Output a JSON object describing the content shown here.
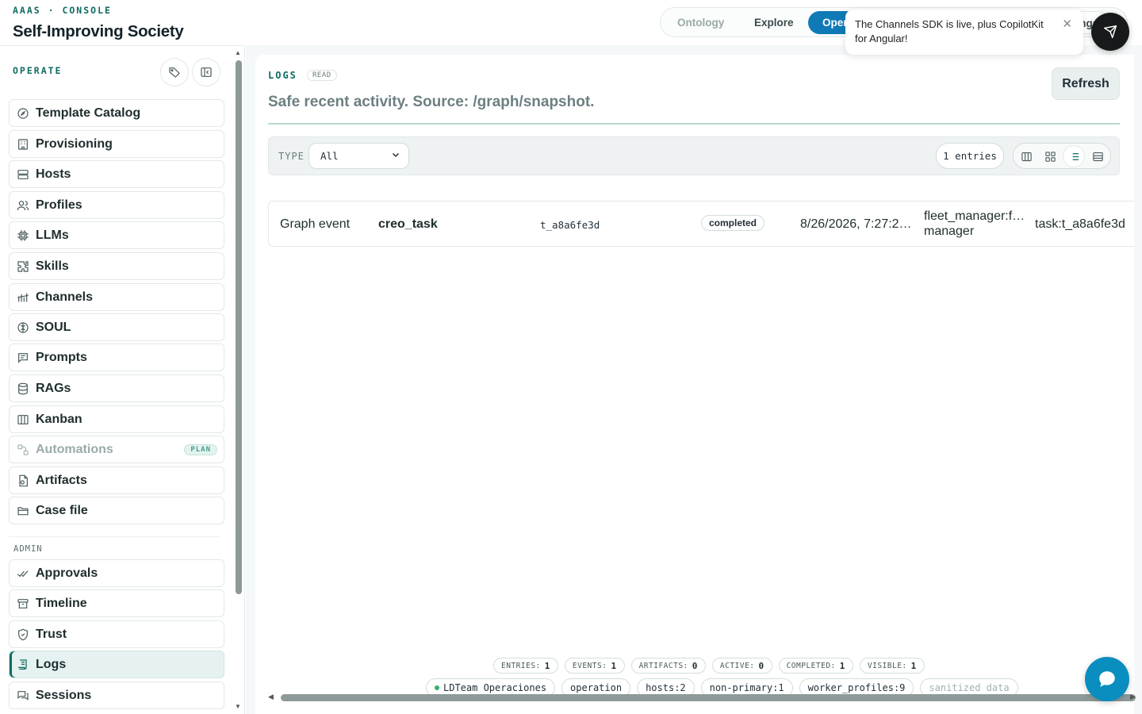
{
  "header": {
    "kicker": "AAAS · CONSOLE",
    "title": "Self-Improving Society",
    "mode_tabs": [
      "Ontology",
      "Explore",
      "Operate",
      "Settings"
    ]
  },
  "toast": {
    "message": "The Channels SDK is live, plus CopilotKit for Angular!",
    "close_icon": "close-icon"
  },
  "sidebar": {
    "section_operate": "OPERATE",
    "operate_items": [
      {
        "label": "Template Catalog",
        "icon": "compass-icon"
      },
      {
        "label": "Provisioning",
        "icon": "building-icon"
      },
      {
        "label": "Hosts",
        "icon": "server-icon"
      },
      {
        "label": "Profiles",
        "icon": "users-icon"
      },
      {
        "label": "LLMs",
        "icon": "cpu-icon"
      },
      {
        "label": "Skills",
        "icon": "puzzle-icon"
      },
      {
        "label": "Channels",
        "icon": "signal-icon"
      },
      {
        "label": "SOUL",
        "icon": "brain-icon"
      },
      {
        "label": "Prompts",
        "icon": "message-icon"
      },
      {
        "label": "RAGs",
        "icon": "database-icon"
      },
      {
        "label": "Kanban",
        "icon": "columns-icon"
      },
      {
        "label": "Automations",
        "icon": "workflow-icon",
        "badge": "PLAN",
        "disabled": true
      },
      {
        "label": "Artifacts",
        "icon": "file-icon"
      },
      {
        "label": "Case file",
        "icon": "folder-icon"
      }
    ],
    "section_admin": "ADMIN",
    "admin_items": [
      {
        "label": "Approvals",
        "icon": "check-icon"
      },
      {
        "label": "Timeline",
        "icon": "archive-icon"
      },
      {
        "label": "Trust",
        "icon": "shield-icon"
      },
      {
        "label": "Logs",
        "icon": "logs-icon",
        "active": true
      },
      {
        "label": "Sessions",
        "icon": "chat-icon"
      }
    ]
  },
  "logs": {
    "kicker": "LOGS",
    "badge": "READ",
    "subtitle": "Safe recent activity. Source: /graph/snapshot.",
    "refresh_label": "Refresh",
    "filter": {
      "type_label": "TYPE",
      "type_value": "All",
      "entries": "1 entries"
    },
    "rows": [
      {
        "kind": "Graph event",
        "name": "creo_task",
        "id": "t_a8a6fe3d",
        "status": "completed",
        "time": "8/26/2026, 7:27:2…",
        "actor_line1": "fleet_manager:f…",
        "actor_line2": "manager",
        "target": "task:t_a8a6fe3d"
      }
    ],
    "stats": [
      {
        "label": "ENTRIES:",
        "value": "1"
      },
      {
        "label": "EVENTS:",
        "value": "1"
      },
      {
        "label": "ARTIFACTS:",
        "value": "0"
      },
      {
        "label": "ACTIVE:",
        "value": "0"
      },
      {
        "label": "COMPLETED:",
        "value": "1"
      },
      {
        "label": "VISIBLE:",
        "value": "1"
      }
    ],
    "tags": [
      "LDTeam Operaciones",
      "operation",
      "hosts:2",
      "non-primary:1",
      "worker_profiles:9",
      "sanitized data"
    ]
  },
  "colors": {
    "accent": "#0f6b62",
    "active_tab": "#0f7ab6",
    "chat_fab": "#0a8ec0",
    "status_dot": "#2fb36d"
  }
}
